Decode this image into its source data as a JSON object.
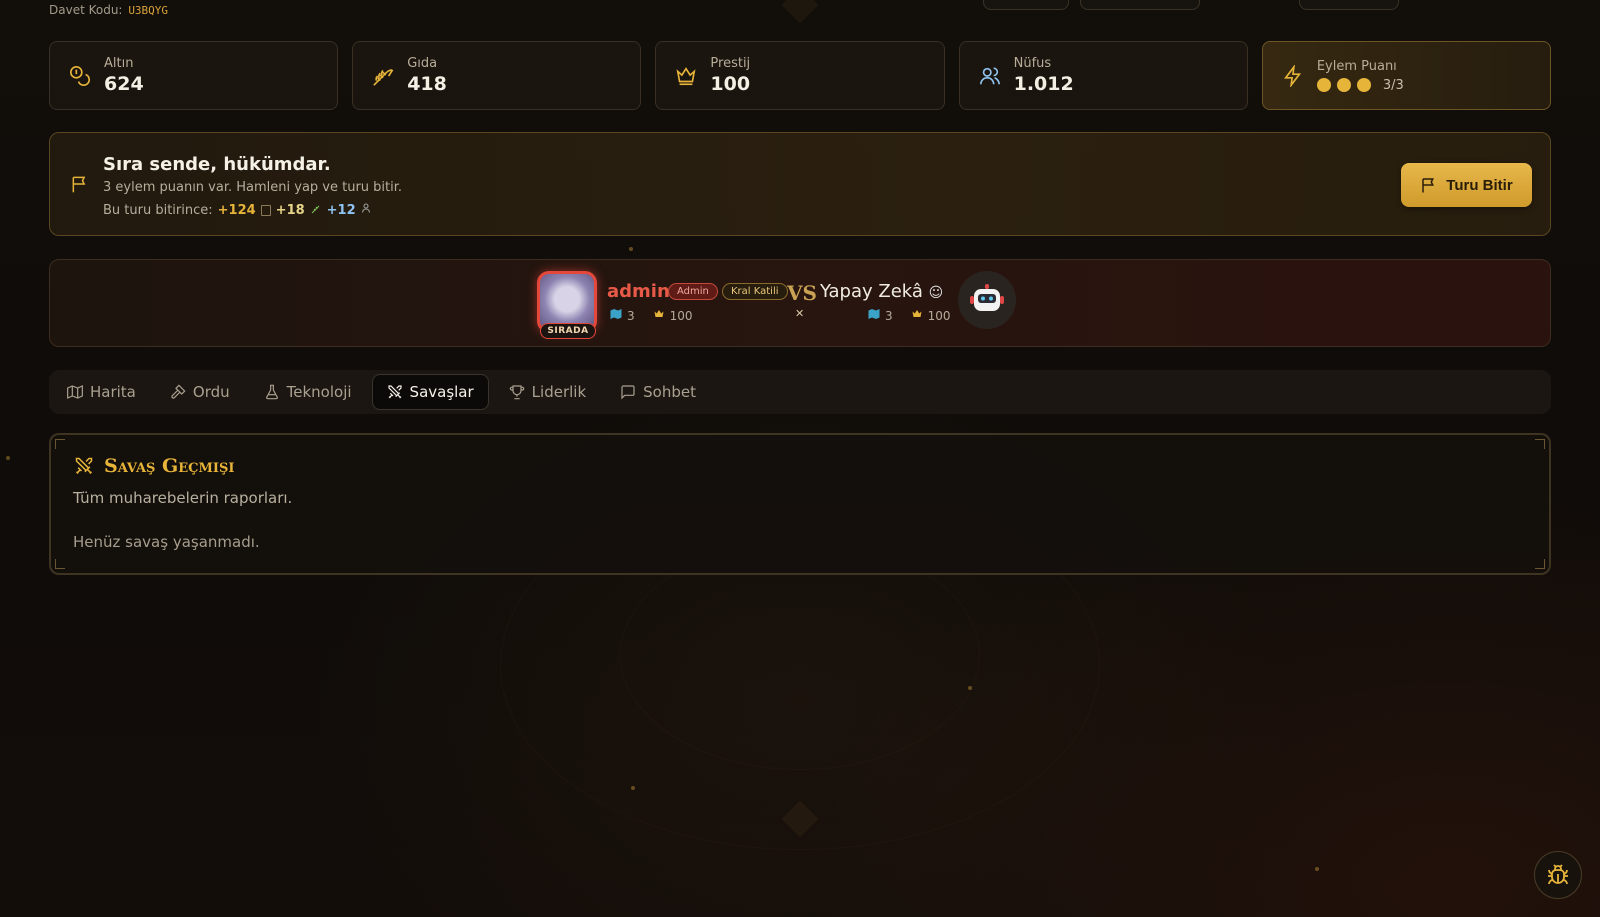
{
  "invite": {
    "label": "Davet Kodu:",
    "code": "U3BQYG"
  },
  "stats": [
    {
      "label": "Altın",
      "value": "624",
      "icon": "coins-icon"
    },
    {
      "label": "Gıda",
      "value": "418",
      "icon": "wheat-icon"
    },
    {
      "label": "Prestij",
      "value": "100",
      "icon": "crown-icon"
    },
    {
      "label": "Nüfus",
      "value": "1.012",
      "icon": "users-icon"
    }
  ],
  "action_points": {
    "label": "Eylem Puanı",
    "current": 3,
    "max": 3,
    "text": "3/3",
    "icon": "lightning-icon"
  },
  "turn": {
    "title": "Sıra sende, hükümdar.",
    "subtitle": "3 eylem puanın var. Hamleni yap ve turu bitir.",
    "forecast_label": "Bu turu bitirince:",
    "gold_gain": "+124",
    "food_gain": "+18",
    "pop_gain": "+12",
    "end_button": "Turu Bitir"
  },
  "match": {
    "player": {
      "name": "admin",
      "badge_role": "Admin",
      "badge_title": "Kral Katili",
      "status": "SIRADA",
      "regions": "3",
      "prestige": "100"
    },
    "vs": "VS",
    "opponent": {
      "name": "Yapay Zekâ",
      "regions": "3",
      "prestige": "100"
    }
  },
  "tabs": [
    {
      "label": "Harita",
      "icon": "map-icon",
      "active": false
    },
    {
      "label": "Ordu",
      "icon": "hammer-icon",
      "active": false
    },
    {
      "label": "Teknoloji",
      "icon": "flask-icon",
      "active": false
    },
    {
      "label": "Savaşlar",
      "icon": "swords-icon",
      "active": true
    },
    {
      "label": "Liderlik",
      "icon": "trophy-icon",
      "active": false
    },
    {
      "label": "Sohbet",
      "icon": "chat-icon",
      "active": false
    }
  ],
  "history": {
    "title": "Savaş Geçmişi",
    "subtitle": "Tüm muharebelerin raporları.",
    "empty": "Henüz savaş yaşanmadı."
  },
  "colors": {
    "accent": "#e7b43a",
    "danger": "#e4483a",
    "background": "#110d0a"
  }
}
